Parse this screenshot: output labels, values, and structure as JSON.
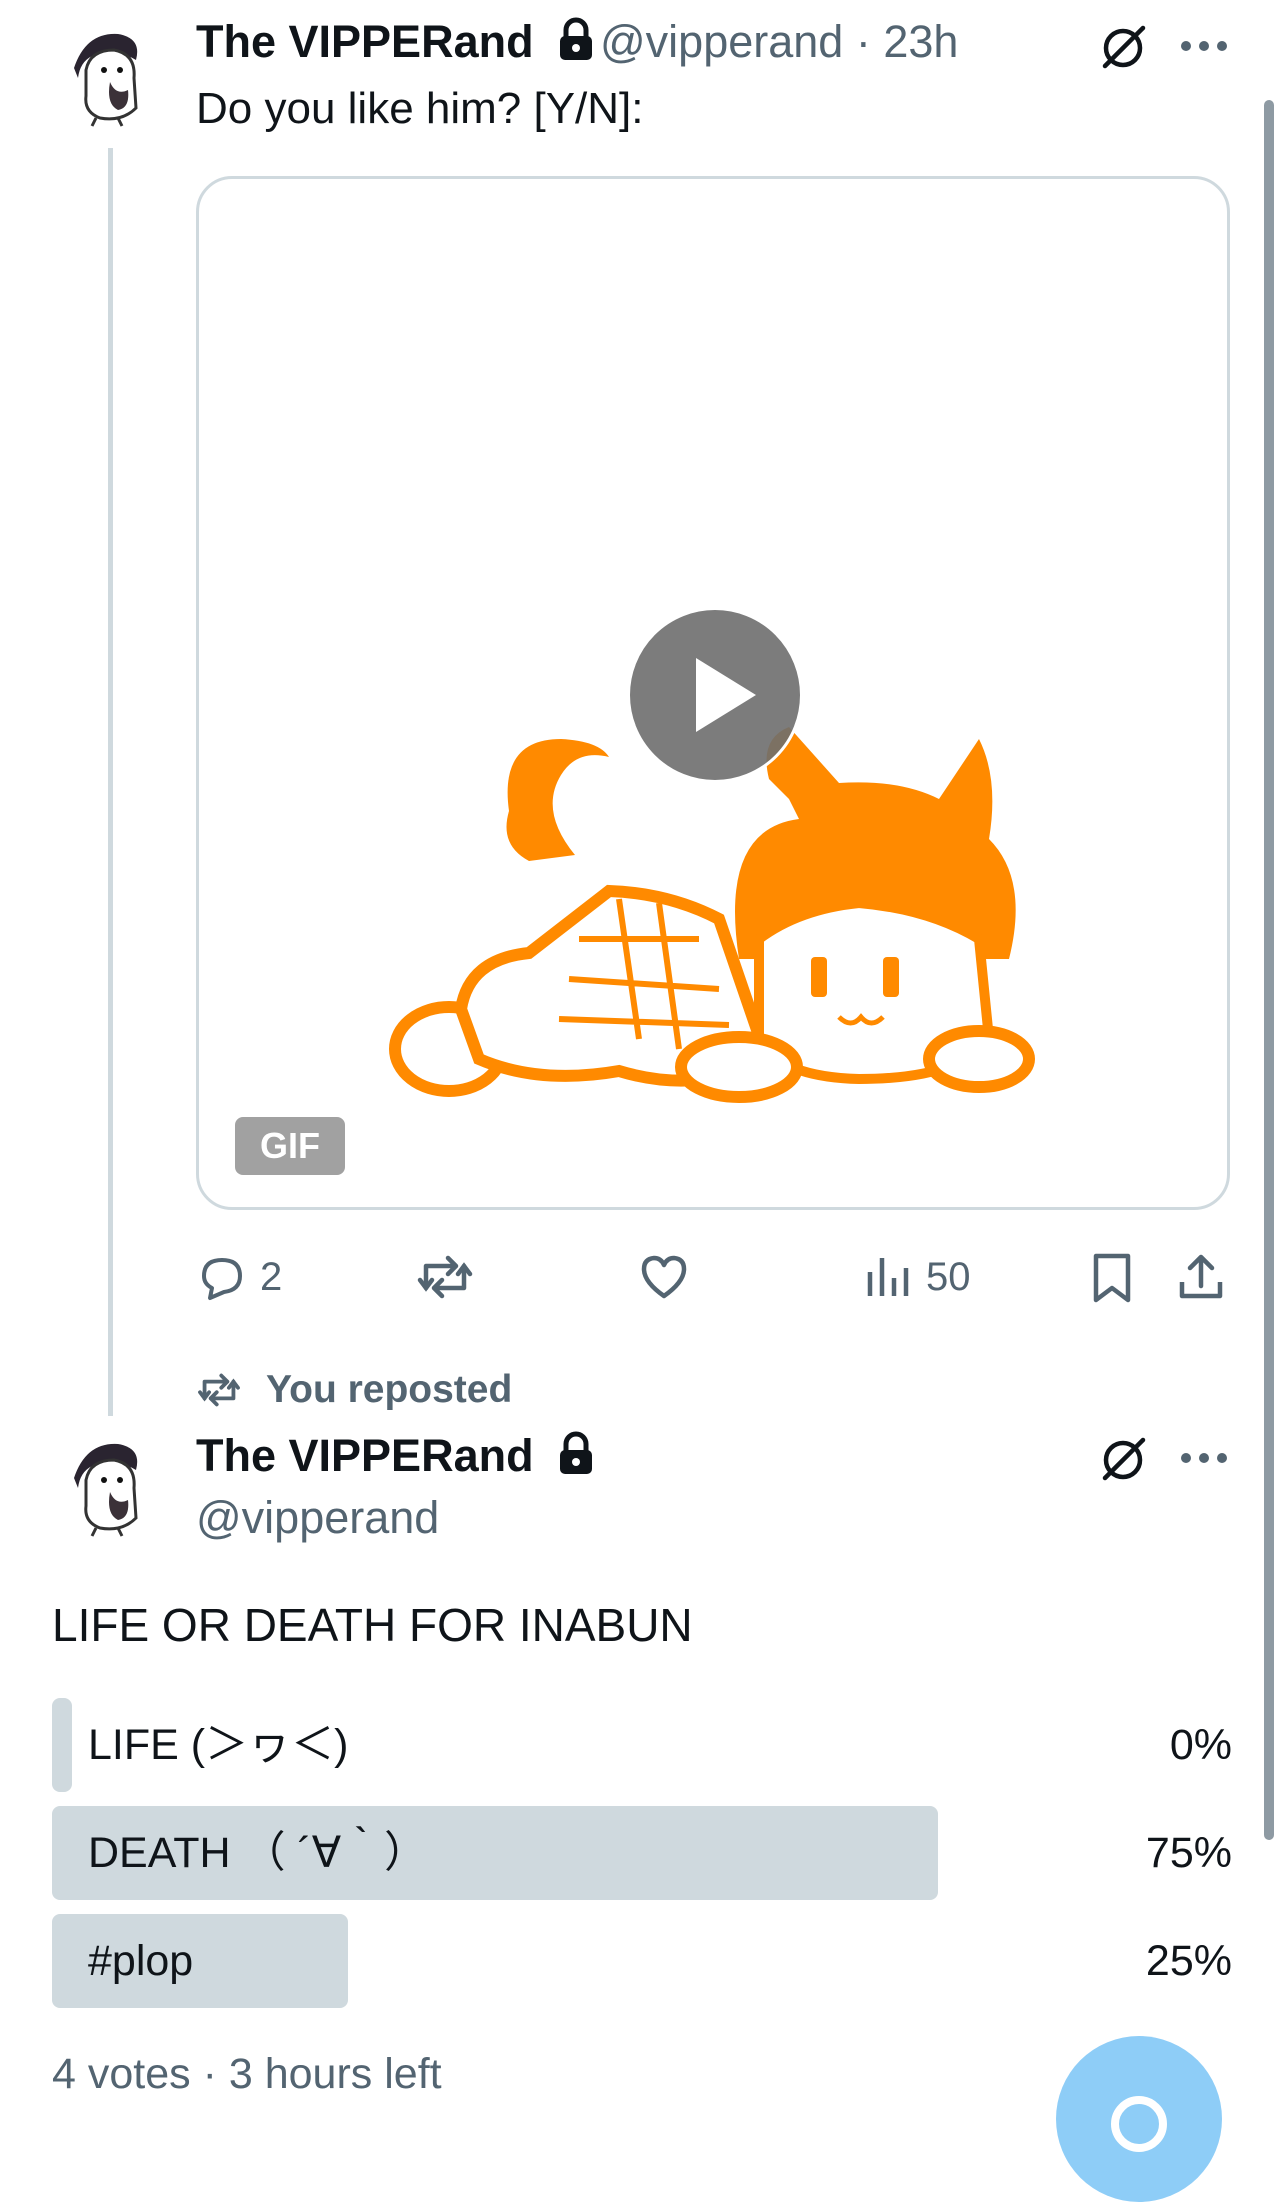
{
  "post1": {
    "display_name": "The VIPPERand",
    "handle": "@vipperand",
    "time": "· 23h",
    "text": "Do you like him? [Y/N]:",
    "media_badge": "GIF",
    "stats": {
      "replies": "2",
      "views": "50"
    }
  },
  "repost_banner": "You reposted",
  "post2": {
    "display_name": "The VIPPERand",
    "handle": "@vipperand",
    "text": "LIFE OR DEATH FOR INABUN",
    "poll": {
      "options": [
        {
          "label": "LIFE (＞ヮ＜)",
          "percent": "0%",
          "value": 0
        },
        {
          "label": "DEATH （ ´∀｀）",
          "percent": "75%",
          "value": 75
        },
        {
          "label": "#plop",
          "percent": "25%",
          "value": 25
        }
      ],
      "footer": "4 votes · 3 hours left"
    }
  },
  "colors": {
    "accent": "#1d9bf0",
    "fab": "#8ecdf7",
    "poll_bar": "#cfd9de",
    "muted_text": "#536471",
    "gif_orange": "#ff8a00"
  },
  "icons": [
    "lock-icon",
    "grok-icon",
    "more-icon",
    "play-icon",
    "reply-icon",
    "repost-icon",
    "like-icon",
    "views-icon",
    "bookmark-icon",
    "share-icon",
    "compose-icon"
  ]
}
